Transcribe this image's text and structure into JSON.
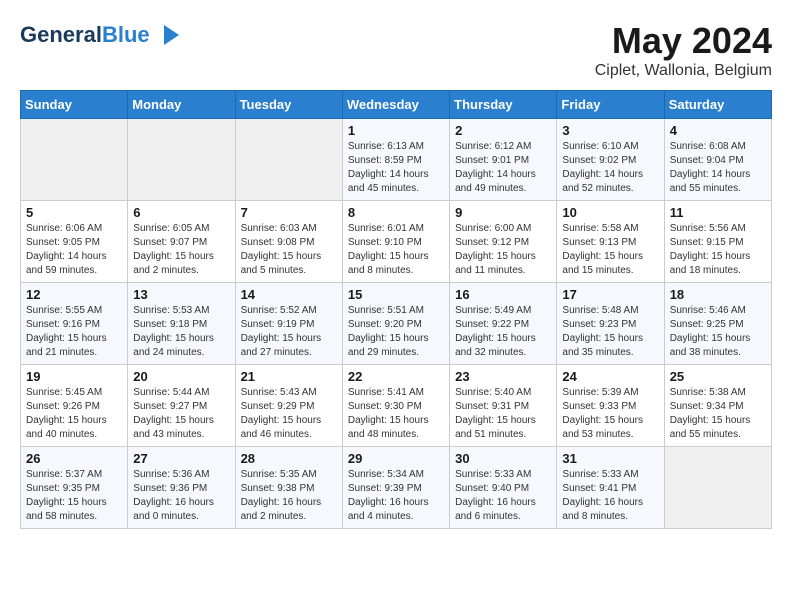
{
  "header": {
    "logo_line1": "General",
    "logo_line2": "Blue",
    "main_title": "May 2024",
    "subtitle": "Ciplet, Wallonia, Belgium"
  },
  "days_of_week": [
    "Sunday",
    "Monday",
    "Tuesday",
    "Wednesday",
    "Thursday",
    "Friday",
    "Saturday"
  ],
  "weeks": [
    [
      {
        "day": "",
        "info": ""
      },
      {
        "day": "",
        "info": ""
      },
      {
        "day": "",
        "info": ""
      },
      {
        "day": "1",
        "info": "Sunrise: 6:13 AM\nSunset: 8:59 PM\nDaylight: 14 hours\nand 45 minutes."
      },
      {
        "day": "2",
        "info": "Sunrise: 6:12 AM\nSunset: 9:01 PM\nDaylight: 14 hours\nand 49 minutes."
      },
      {
        "day": "3",
        "info": "Sunrise: 6:10 AM\nSunset: 9:02 PM\nDaylight: 14 hours\nand 52 minutes."
      },
      {
        "day": "4",
        "info": "Sunrise: 6:08 AM\nSunset: 9:04 PM\nDaylight: 14 hours\nand 55 minutes."
      }
    ],
    [
      {
        "day": "5",
        "info": "Sunrise: 6:06 AM\nSunset: 9:05 PM\nDaylight: 14 hours\nand 59 minutes."
      },
      {
        "day": "6",
        "info": "Sunrise: 6:05 AM\nSunset: 9:07 PM\nDaylight: 15 hours\nand 2 minutes."
      },
      {
        "day": "7",
        "info": "Sunrise: 6:03 AM\nSunset: 9:08 PM\nDaylight: 15 hours\nand 5 minutes."
      },
      {
        "day": "8",
        "info": "Sunrise: 6:01 AM\nSunset: 9:10 PM\nDaylight: 15 hours\nand 8 minutes."
      },
      {
        "day": "9",
        "info": "Sunrise: 6:00 AM\nSunset: 9:12 PM\nDaylight: 15 hours\nand 11 minutes."
      },
      {
        "day": "10",
        "info": "Sunrise: 5:58 AM\nSunset: 9:13 PM\nDaylight: 15 hours\nand 15 minutes."
      },
      {
        "day": "11",
        "info": "Sunrise: 5:56 AM\nSunset: 9:15 PM\nDaylight: 15 hours\nand 18 minutes."
      }
    ],
    [
      {
        "day": "12",
        "info": "Sunrise: 5:55 AM\nSunset: 9:16 PM\nDaylight: 15 hours\nand 21 minutes."
      },
      {
        "day": "13",
        "info": "Sunrise: 5:53 AM\nSunset: 9:18 PM\nDaylight: 15 hours\nand 24 minutes."
      },
      {
        "day": "14",
        "info": "Sunrise: 5:52 AM\nSunset: 9:19 PM\nDaylight: 15 hours\nand 27 minutes."
      },
      {
        "day": "15",
        "info": "Sunrise: 5:51 AM\nSunset: 9:20 PM\nDaylight: 15 hours\nand 29 minutes."
      },
      {
        "day": "16",
        "info": "Sunrise: 5:49 AM\nSunset: 9:22 PM\nDaylight: 15 hours\nand 32 minutes."
      },
      {
        "day": "17",
        "info": "Sunrise: 5:48 AM\nSunset: 9:23 PM\nDaylight: 15 hours\nand 35 minutes."
      },
      {
        "day": "18",
        "info": "Sunrise: 5:46 AM\nSunset: 9:25 PM\nDaylight: 15 hours\nand 38 minutes."
      }
    ],
    [
      {
        "day": "19",
        "info": "Sunrise: 5:45 AM\nSunset: 9:26 PM\nDaylight: 15 hours\nand 40 minutes."
      },
      {
        "day": "20",
        "info": "Sunrise: 5:44 AM\nSunset: 9:27 PM\nDaylight: 15 hours\nand 43 minutes."
      },
      {
        "day": "21",
        "info": "Sunrise: 5:43 AM\nSunset: 9:29 PM\nDaylight: 15 hours\nand 46 minutes."
      },
      {
        "day": "22",
        "info": "Sunrise: 5:41 AM\nSunset: 9:30 PM\nDaylight: 15 hours\nand 48 minutes."
      },
      {
        "day": "23",
        "info": "Sunrise: 5:40 AM\nSunset: 9:31 PM\nDaylight: 15 hours\nand 51 minutes."
      },
      {
        "day": "24",
        "info": "Sunrise: 5:39 AM\nSunset: 9:33 PM\nDaylight: 15 hours\nand 53 minutes."
      },
      {
        "day": "25",
        "info": "Sunrise: 5:38 AM\nSunset: 9:34 PM\nDaylight: 15 hours\nand 55 minutes."
      }
    ],
    [
      {
        "day": "26",
        "info": "Sunrise: 5:37 AM\nSunset: 9:35 PM\nDaylight: 15 hours\nand 58 minutes."
      },
      {
        "day": "27",
        "info": "Sunrise: 5:36 AM\nSunset: 9:36 PM\nDaylight: 16 hours\nand 0 minutes."
      },
      {
        "day": "28",
        "info": "Sunrise: 5:35 AM\nSunset: 9:38 PM\nDaylight: 16 hours\nand 2 minutes."
      },
      {
        "day": "29",
        "info": "Sunrise: 5:34 AM\nSunset: 9:39 PM\nDaylight: 16 hours\nand 4 minutes."
      },
      {
        "day": "30",
        "info": "Sunrise: 5:33 AM\nSunset: 9:40 PM\nDaylight: 16 hours\nand 6 minutes."
      },
      {
        "day": "31",
        "info": "Sunrise: 5:33 AM\nSunset: 9:41 PM\nDaylight: 16 hours\nand 8 minutes."
      },
      {
        "day": "",
        "info": ""
      }
    ]
  ]
}
